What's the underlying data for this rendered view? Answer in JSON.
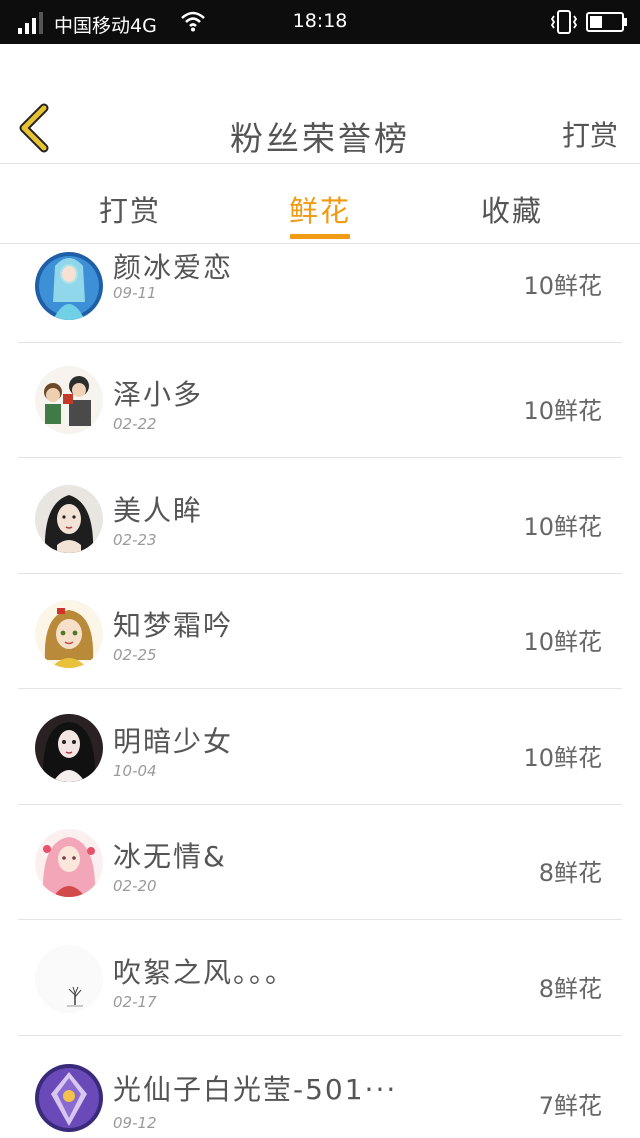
{
  "status_bar": {
    "carrier": "中国移动4G",
    "time": "18:18"
  },
  "header": {
    "title": "粉丝荣誉榜",
    "action_label": "打赏",
    "back_icon": "chevron-left-icon"
  },
  "tabs": [
    {
      "label": "打赏",
      "active": false
    },
    {
      "label": "鲜花",
      "active": true
    },
    {
      "label": "收藏",
      "active": false
    }
  ],
  "colors": {
    "accent": "#f19a14",
    "back_icon": "#e8c230"
  },
  "list": [
    {
      "name": "颜冰爱恋",
      "date": "09-11",
      "amount": "10鲜花",
      "avatar": "avatar-ice-princess"
    },
    {
      "name": "泽小多",
      "date": "02-22",
      "amount": "10鲜花",
      "avatar": "avatar-cartoon-pair"
    },
    {
      "name": "美人眸",
      "date": "02-23",
      "amount": "10鲜花",
      "avatar": "avatar-beauty"
    },
    {
      "name": "知梦霜吟",
      "date": "02-25",
      "amount": "10鲜花",
      "avatar": "avatar-anime-girl"
    },
    {
      "name": "明暗少女",
      "date": "10-04",
      "amount": "10鲜花",
      "avatar": "avatar-doll"
    },
    {
      "name": "冰无情&",
      "date": "02-20",
      "amount": "8鲜花",
      "avatar": "avatar-pink-girl"
    },
    {
      "name": "吹絮之风。。。",
      "date": "02-17",
      "amount": "8鲜花",
      "avatar": "avatar-lone-tree"
    },
    {
      "name": "光仙子白光莹-501···",
      "date": "09-12",
      "amount": "7鲜花",
      "avatar": "avatar-crystal"
    }
  ]
}
